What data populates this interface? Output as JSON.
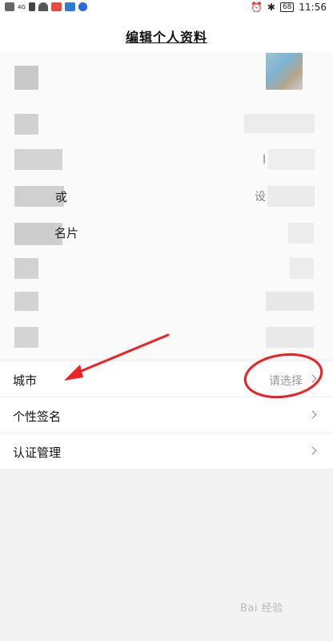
{
  "status_bar": {
    "left_icons": [
      "hd-icon",
      "signal-4g-icon",
      "wifi-icon",
      "app-red-icon",
      "app-cloud-icon",
      "app-shield-icon"
    ],
    "network_label": "4G",
    "battery": "68",
    "time": "11:56"
  },
  "header": {
    "title": "编辑个人资料"
  },
  "blurred_fragments": {
    "row4_suffix": "戓",
    "row4_value_fragment": "设",
    "row5_suffix": "名片",
    "row3_value_fragment": "l"
  },
  "rows": [
    {
      "label": "城市",
      "value": "请选择"
    },
    {
      "label": "个性签名",
      "value": ""
    },
    {
      "label": "认证管理",
      "value": ""
    }
  ],
  "watermark": "Bai 经验",
  "colors": {
    "annotation_red": "#ee2222",
    "value_gray": "#999999"
  }
}
